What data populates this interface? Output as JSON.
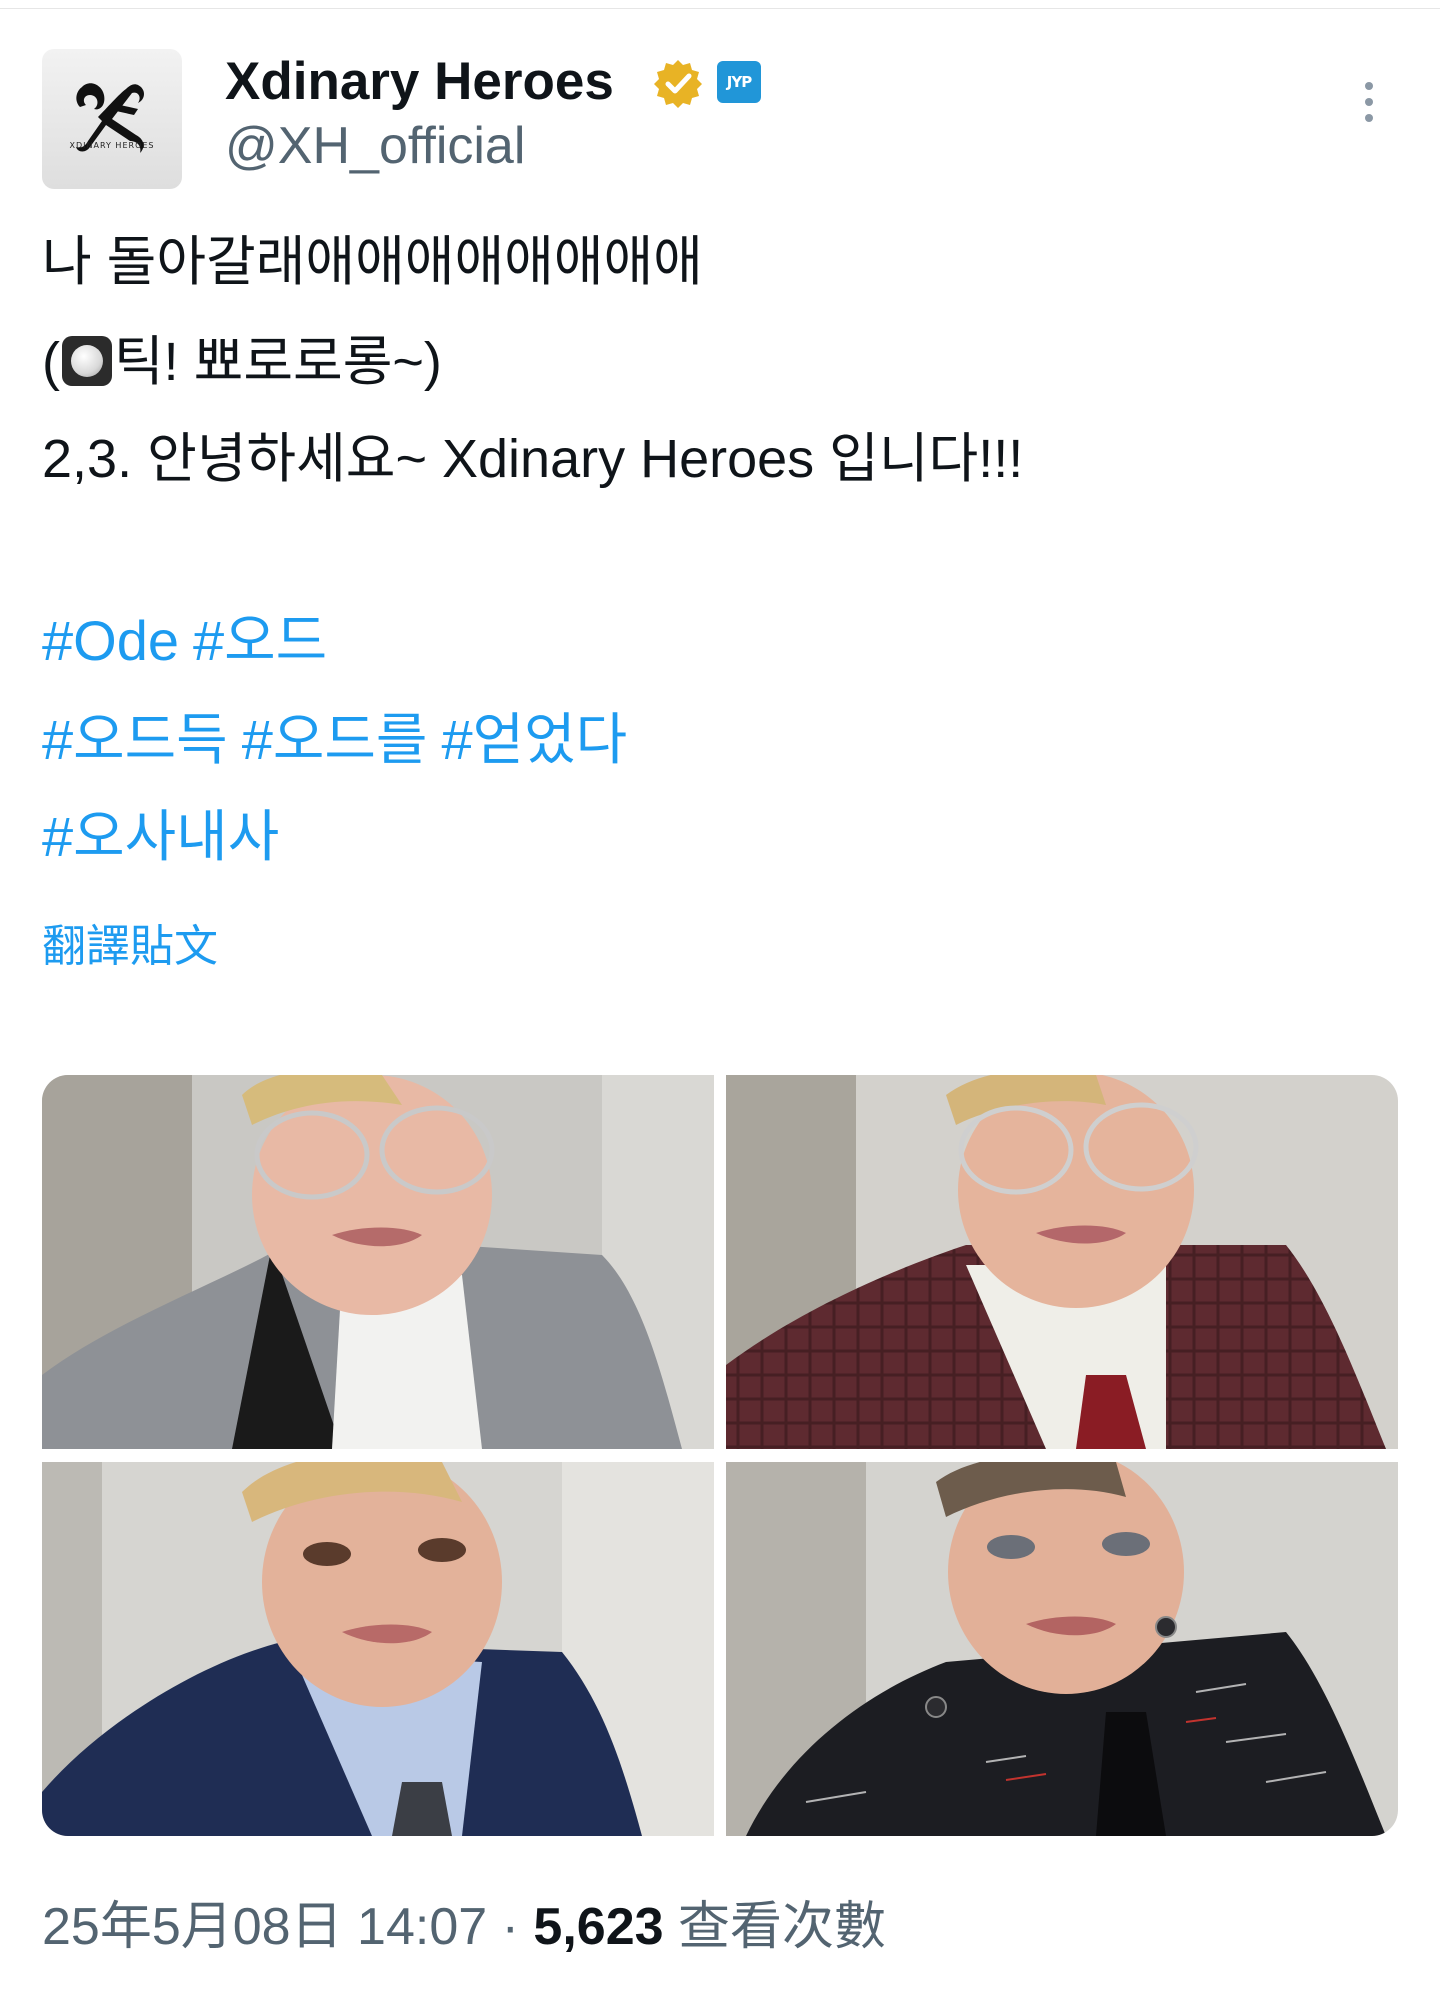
{
  "author": {
    "display_name": "Xdinary Heroes",
    "handle": "@XH_official",
    "avatar_text": "XDINARY HEROES",
    "org_badge": "JYP",
    "verified_color": "#e8b325"
  },
  "tweet": {
    "line1": "나 돌아갈래애애애애애애애애",
    "line2_open": "(",
    "line2_rest": "틱! 뾰로로롱~)",
    "line3": "2,3. 안녕하세요~ Xdinary Heroes 입니다!!!",
    "hashtags_row1": [
      "#Ode",
      "#오드"
    ],
    "hashtags_row2": [
      "#오드득",
      "#오드를",
      "#얻었다"
    ],
    "hashtags_row3": [
      "#오사내사"
    ],
    "translate_label": "翻譯貼文"
  },
  "media": {
    "count": 4,
    "photos": [
      {
        "outfit": "grey blazer, black scarf",
        "glasses": true
      },
      {
        "outfit": "red plaid blazer, striped shirt",
        "glasses": true
      },
      {
        "outfit": "navy blazer, light blue shirt",
        "glasses": false
      },
      {
        "outfit": "black embroidered jacket",
        "glasses": false
      }
    ]
  },
  "meta": {
    "timestamp": "25年5月08日 14:07",
    "separator": " · ",
    "views_count": "5,623",
    "views_label": " 查看次數"
  },
  "colors": {
    "link": "#1d9bf0",
    "text": "#0f1419",
    "muted": "#536471"
  },
  "icons": [
    "verified-icon",
    "more-icon",
    "radio-button-emoji"
  ]
}
